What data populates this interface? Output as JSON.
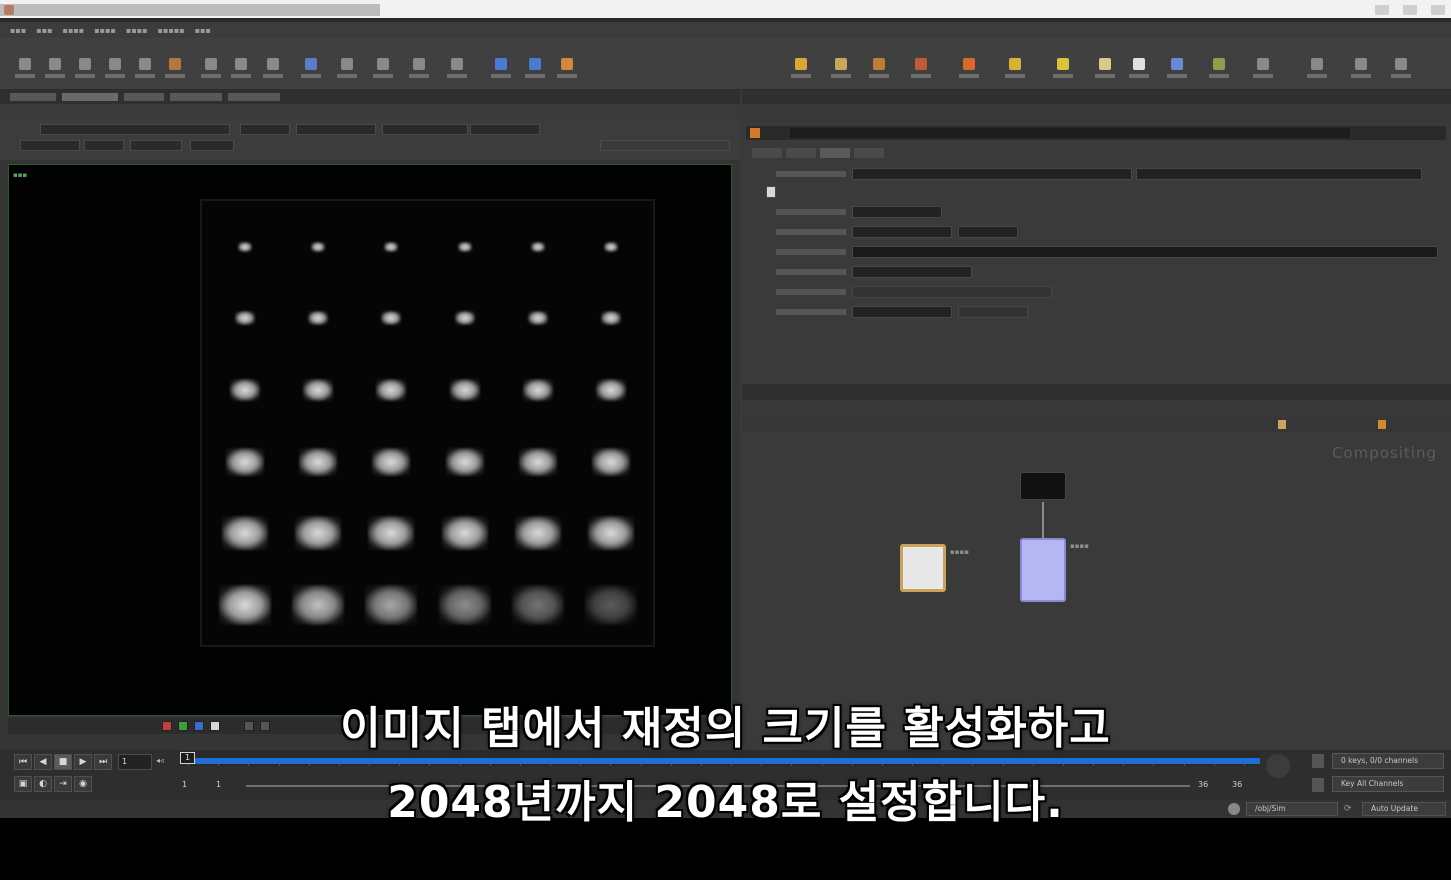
{
  "timeline": {
    "current_frame": "1",
    "cursor_frame": "1",
    "start_frame": "1",
    "start_frame_2": "1",
    "end_frame": "36",
    "end_frame_2": "36",
    "ruler_end": "36",
    "keys_status": "0 keys, 0/0 channels",
    "key_mode": "Key All Channels"
  },
  "status": {
    "path": "/obj/Sim",
    "update_mode": "Auto Update"
  },
  "network": {
    "context_label": "Compositing"
  },
  "viewer": {
    "colors": [
      "#c04040",
      "#3aa03a",
      "#3a6ec8",
      "#d8d8d8"
    ]
  },
  "subtitles": {
    "line1": "이미지 탭에서 재정의 크기를 활성화하고",
    "line2": "2048년까지 2048로 설정합니다."
  }
}
